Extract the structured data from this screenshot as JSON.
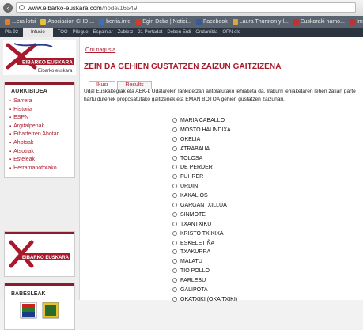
{
  "browser": {
    "url_host": "www.eibarko-euskara.com",
    "url_path": "/node/16549",
    "bookmarks": [
      {
        "label": "...era lotsi",
        "color": "#e0802a"
      },
      {
        "label": "Asociación CHDI...",
        "color": "#e8c13a"
      },
      {
        "label": "berria.info",
        "color": "#3c6fbf"
      },
      {
        "label": "Egin Deba | Notici...",
        "color": "#d23a2a"
      },
      {
        "label": "Facebook",
        "color": "#3b5998"
      },
      {
        "label": "Laura Thurston y l...",
        "color": "#d9a83a"
      },
      {
        "label": "Euskaraki hamo...",
        "color": "#c43030"
      },
      {
        "label": "Impricat ne",
        "color": "#b33"
      }
    ],
    "tabs": [
      "Pla 92",
      "Infusio",
      "TOO",
      "Pliegue",
      "Espainiar",
      "Zubietz",
      "21 Portadat",
      "Deben Erdi",
      "Ondarribia",
      "OPN elo"
    ],
    "active_tab_index": 1
  },
  "sidebar": {
    "logo_text": "EIBARKO EUSKARA",
    "menu_title": "AURKIBIDEA",
    "menu_items": [
      "Sarrera",
      "Historia",
      "ESPN",
      "Argitalpenak",
      "Eibarterren Ahotan",
      "Ahotsak",
      "Atsotrak",
      "Esteleak",
      "Herramanotorako"
    ],
    "banner_text": "EIBARKO EUSKARA",
    "partners_title": "BABESLEAK"
  },
  "main": {
    "breadcrumb": "Orri nagusia",
    "title": "ZEIN DA GEHIEN GUSTATZEN ZAIZUN GAITZIZENA",
    "tabs": [
      "Ikusi",
      "Results"
    ],
    "active_tab_index": 0,
    "intro": "Udal Euskaltegiak eta AEK-k Udalarekin lankidetzan antolatutako lehiaketa da. Irakurri lehiaketaren lehen zatian parte hartu dutenek proposatutako gaitizenek eta EMAN BOTOA gehien gustatzen zaizunari.",
    "options": [
      "MARIA CABALLO",
      "MOSTO HAUNDIXA",
      "OKELIA",
      "ATRABAUA",
      "TOLOSA",
      "DE PERDER",
      "FUHRER",
      "URDIN",
      "KAKALIOS",
      "GARGANTXILLUA",
      "SINMOTE",
      "TXANTXIKU",
      "KRISTO TXIKIXA",
      "ESKELETIÑA",
      "TXAKURRA",
      "MALATU",
      "TIO POLLO",
      "PARLEBU",
      "GALIPOTA",
      "OKATXIKI (OKA TXIKI)"
    ]
  },
  "colors": {
    "brand_red": "#a7192b",
    "link_red": "#b01d2e"
  }
}
